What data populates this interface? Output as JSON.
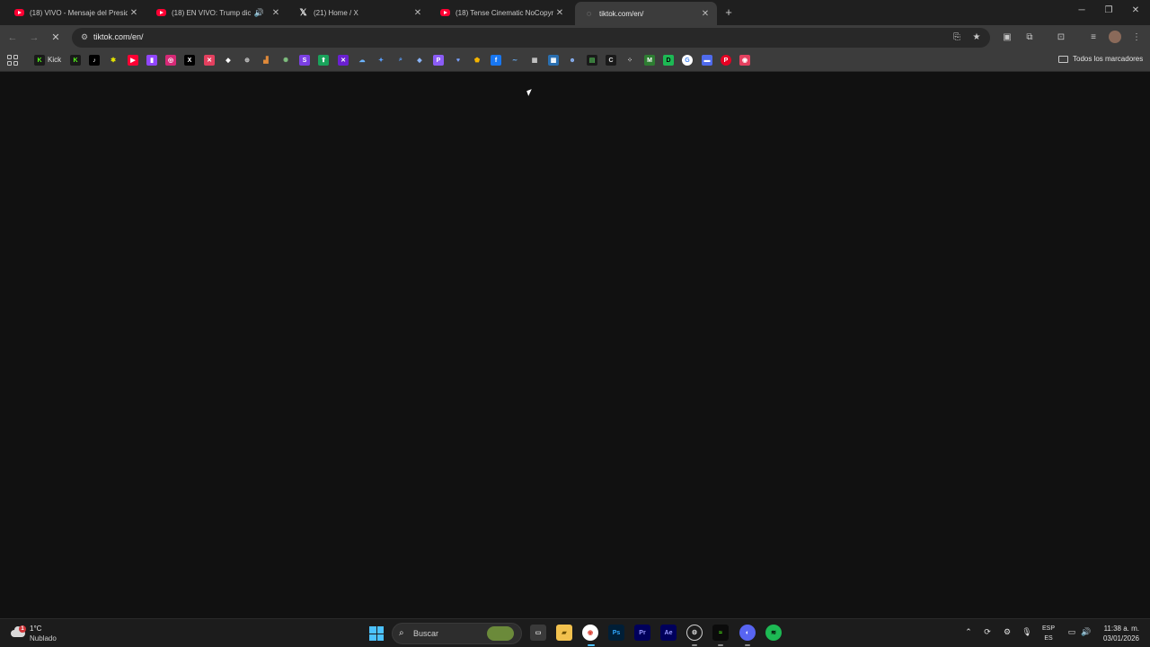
{
  "tabs": [
    {
      "title": "(18) VIVO - Mensaje del Preside",
      "icon": "youtube-icon"
    },
    {
      "title": "(18) EN VIVO: Trump dice q",
      "icon": "youtube-icon",
      "sound": true
    },
    {
      "title": "(21) Home / X",
      "icon": "x-icon"
    },
    {
      "title": "(18) Tense Cinematic NoCopyri",
      "icon": "youtube-icon"
    },
    {
      "title": "tiktok.com/en/",
      "icon": "loading-icon",
      "active": true
    }
  ],
  "toolbar": {
    "url": "tiktok.com/en/"
  },
  "bookmarks": {
    "first_label": "Kick",
    "all_bookmarks_label": "Todos los marcadores"
  },
  "taskbar": {
    "weather_temp": "1°C",
    "weather_condition": "Nublado",
    "weather_alert": "1",
    "search_placeholder": "Buscar",
    "language_top": "ESP",
    "language_bottom": "ES",
    "time": "11:38 a. m.",
    "date": "03/01/2026"
  },
  "colors": {
    "page_bg": "#111111",
    "chrome_bg": "#3c3c3c",
    "tabstrip_bg": "#1f1f1f",
    "taskbar_bg": "#1c1c1c",
    "accent": "#4cc2ff"
  }
}
